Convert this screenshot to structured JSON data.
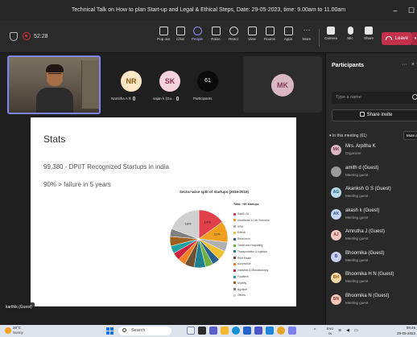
{
  "window": {
    "title": "Technical Talk on How to plan Start-up and Legal & Ethical Steps, Date: 29-05-2023, time: 9.00am to 11.00am",
    "minimize": "–",
    "maximize": "☐"
  },
  "toolbar": {
    "timer": "52:28",
    "buttons": [
      {
        "label": "Pop out",
        "icon": "pop-out-icon"
      },
      {
        "label": "Chat",
        "icon": "chat-icon"
      },
      {
        "label": "People",
        "icon": "people-icon"
      },
      {
        "label": "Raise",
        "icon": "raise-hand-icon"
      },
      {
        "label": "React",
        "icon": "react-icon"
      },
      {
        "label": "View",
        "icon": "view-icon"
      },
      {
        "label": "Rooms",
        "icon": "rooms-icon"
      },
      {
        "label": "Apps",
        "icon": "apps-icon"
      },
      {
        "label": "More",
        "icon": "more-icon"
      }
    ],
    "devices": [
      {
        "label": "Camera",
        "icon": "camera-icon"
      },
      {
        "label": "Mic",
        "icon": "mic-icon"
      },
      {
        "label": "Share",
        "icon": "share-icon"
      }
    ],
    "leave": "Leave"
  },
  "stage": {
    "self_name": "karthik (Guest)",
    "avatars": [
      {
        "initials": "NR",
        "name": "Namitha A R",
        "bg": "#fde7c6",
        "fg": "#8a5a12"
      },
      {
        "initials": "SK",
        "name": "sajan k (Gu...",
        "bg": "#f6d2dd",
        "fg": "#8b2d4e"
      }
    ],
    "participant_count": "61",
    "participant_count_label": "Participants",
    "tile_initials": "MK"
  },
  "slide": {
    "title": "Stats",
    "lines": [
      "99,380 - DPIIT Recognized Startups in india",
      "90% > failure in 5 years"
    ]
  },
  "chart_data": {
    "type": "pie",
    "title": "Sector-wise split of startups (2016-2019)",
    "legend_title": "Total: ~9K startups",
    "categories": [
      "SaaS / AI",
      "Healthcare & Life Sciences",
      "SPM",
      "Edtech",
      "Retail tech",
      "Travel and Hospitality",
      "Transportation & logistics",
      "Real Estate",
      "Automotive",
      "Industrial & Manufacturing",
      "Foodtech",
      "Mobility",
      "Agritech",
      "Others"
    ],
    "values": [
      14,
      11,
      5,
      5,
      4,
      4,
      6,
      5,
      4,
      4,
      4,
      5,
      4,
      18
    ],
    "colors": [
      "#e0404a",
      "#f0a020",
      "#b0b0b0",
      "#f0c030",
      "#2a6090",
      "#70b040",
      "#208090",
      "#705030",
      "#f08020",
      "#d02040",
      "#20a0a0",
      "#a06020",
      "#808080",
      "#d0d0d0"
    ],
    "data_labels": [
      "14%",
      "11%",
      "",
      "",
      "",
      "",
      "",
      "",
      "",
      "",
      "",
      "",
      "",
      "18%"
    ],
    "legend_placement": "right"
  },
  "participants": {
    "title": "Participants",
    "more": "···",
    "close": "×",
    "search_placeholder": "Type a name",
    "share_invite": "Share invite",
    "section_label": "In this meeting (61)",
    "mute_all": "Mute all",
    "list": [
      {
        "initials": "MK",
        "name": "Mrs. Arpitha K",
        "role": "Organizer",
        "bg": "#d9b8c4",
        "fg": "#7d3b57"
      },
      {
        "initials": "",
        "name": "amith d (Guest)",
        "role": "Meeting guest",
        "bg": "#9a9a9a",
        "fg": "#fff"
      },
      {
        "initials": "AG",
        "name": "Akanksh G S (Guest)",
        "role": "Meeting guest",
        "bg": "#b9dcec",
        "fg": "#1f5d7c"
      },
      {
        "initials": "AK",
        "name": "akash k (Guest)",
        "role": "Meeting guest",
        "bg": "#c5d6f2",
        "fg": "#2c4d8a"
      },
      {
        "initials": "AJ",
        "name": "Amrutha J (Guest)",
        "role": "Meeting guest",
        "bg": "#f2c9c2",
        "fg": "#8a3b2e"
      },
      {
        "initials": "B",
        "name": "Bhoomika (Guest)",
        "role": "Meeting guest",
        "bg": "#c8cff2",
        "fg": "#3d468f"
      },
      {
        "initials": "BH",
        "name": "Bhoomika H N (Guest)",
        "role": "Meeting guest",
        "bg": "#f7d9a6",
        "fg": "#8a5a12"
      },
      {
        "initials": "BN",
        "name": "Bhoomika N (Guest)",
        "role": "Meeting guest",
        "bg": "#f5c6b9",
        "fg": "#8a3b2e"
      }
    ]
  },
  "taskbar": {
    "temp": "28°C",
    "condition": "Sunny",
    "search": "Search",
    "lang_top": "ENG",
    "lang_bottom": "IN",
    "time": "09:49",
    "date": "29-05-2023"
  }
}
